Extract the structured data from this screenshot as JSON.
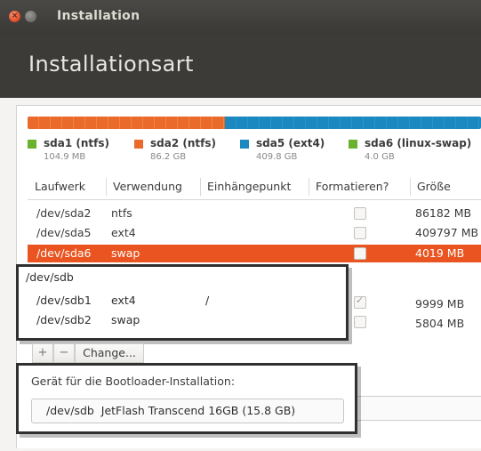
{
  "window": {
    "title": "Installation"
  },
  "header": {
    "title": "Installationsart"
  },
  "partition_bar": {
    "colors": {
      "ntfs": "#e96a2a",
      "ext4": "#1c88c0",
      "swap": "#9ac33a"
    }
  },
  "legend": [
    {
      "name": "sda1 (ntfs)",
      "size": "104.9 MB",
      "color": "#6ab22e"
    },
    {
      "name": "sda2 (ntfs)",
      "size": "86.2 GB",
      "color": "#e96a2a"
    },
    {
      "name": "sda5 (ext4)",
      "size": "409.8 GB",
      "color": "#1c88c0"
    },
    {
      "name": "sda6 (linux-swap)",
      "size": "4.0 GB",
      "color": "#6ab22e"
    }
  ],
  "table": {
    "headers": [
      "Laufwerk",
      "Verwendung",
      "Einhängepunkt",
      "Formatieren?",
      "Größe"
    ],
    "rows": [
      {
        "device": "/dev/sda2",
        "type": "ntfs",
        "mount": "",
        "format": false,
        "size": "86182 MB"
      },
      {
        "device": "/dev/sda5",
        "type": "ext4",
        "mount": "",
        "format": false,
        "size": "409797 MB"
      },
      {
        "device": "/dev/sda6",
        "type": "swap",
        "mount": "",
        "format": false,
        "size": "4019 MB",
        "selected": true
      }
    ],
    "sdb": {
      "device": "/dev/sdb",
      "rows": [
        {
          "device": "/dev/sdb1",
          "type": "ext4",
          "mount": "/",
          "format": true,
          "size": "9999 MB"
        },
        {
          "device": "/dev/sdb2",
          "type": "swap",
          "mount": "",
          "format": false,
          "size": "5804 MB"
        }
      ]
    }
  },
  "toolbar": {
    "add": "+",
    "remove": "−",
    "change": "Change..."
  },
  "bootloader": {
    "label": "Gerät für die Bootloader-Installation:",
    "device": "/dev/sdb",
    "description": "JetFlash Transcend 16GB (15.8 GB)"
  }
}
